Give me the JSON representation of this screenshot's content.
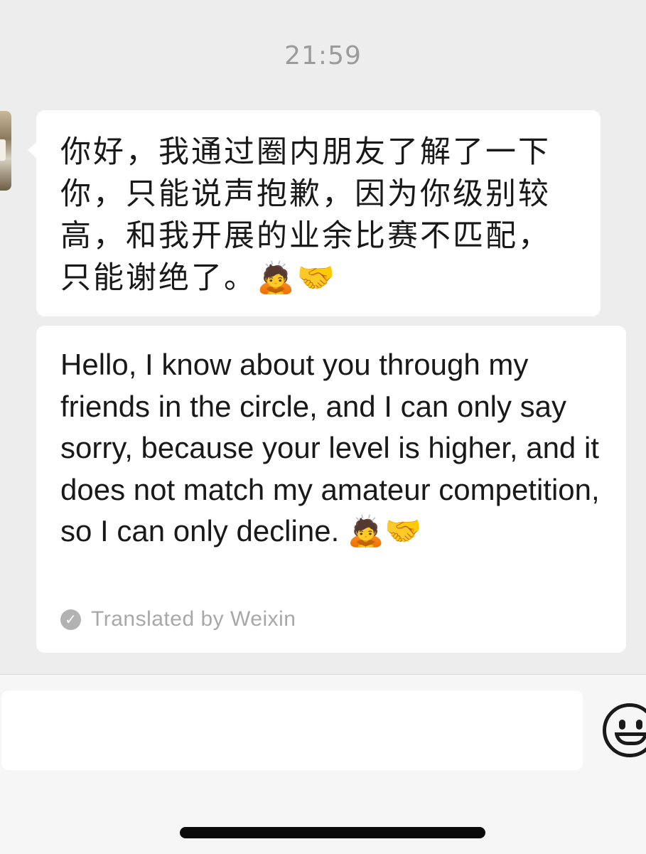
{
  "chat": {
    "timestamp": "21:59",
    "message_cn": "你好，我通过圈内朋友了解了一下你，只能说声抱歉，因为你级别较高，和我开展的业余比赛不匹配，只能谢绝了。🙇🤝",
    "message_en": "Hello, I know about you through my friends in the circle, and I can only say sorry, because your level is higher, and it does not match my amateur competition, so I can only decline. 🙇🤝",
    "translated_label": "Translated by Weixin"
  },
  "input": {
    "value": "",
    "placeholder": ""
  },
  "icons": {
    "emoji_button": "smiley-face-icon",
    "translated_check": "check-circle-icon"
  }
}
